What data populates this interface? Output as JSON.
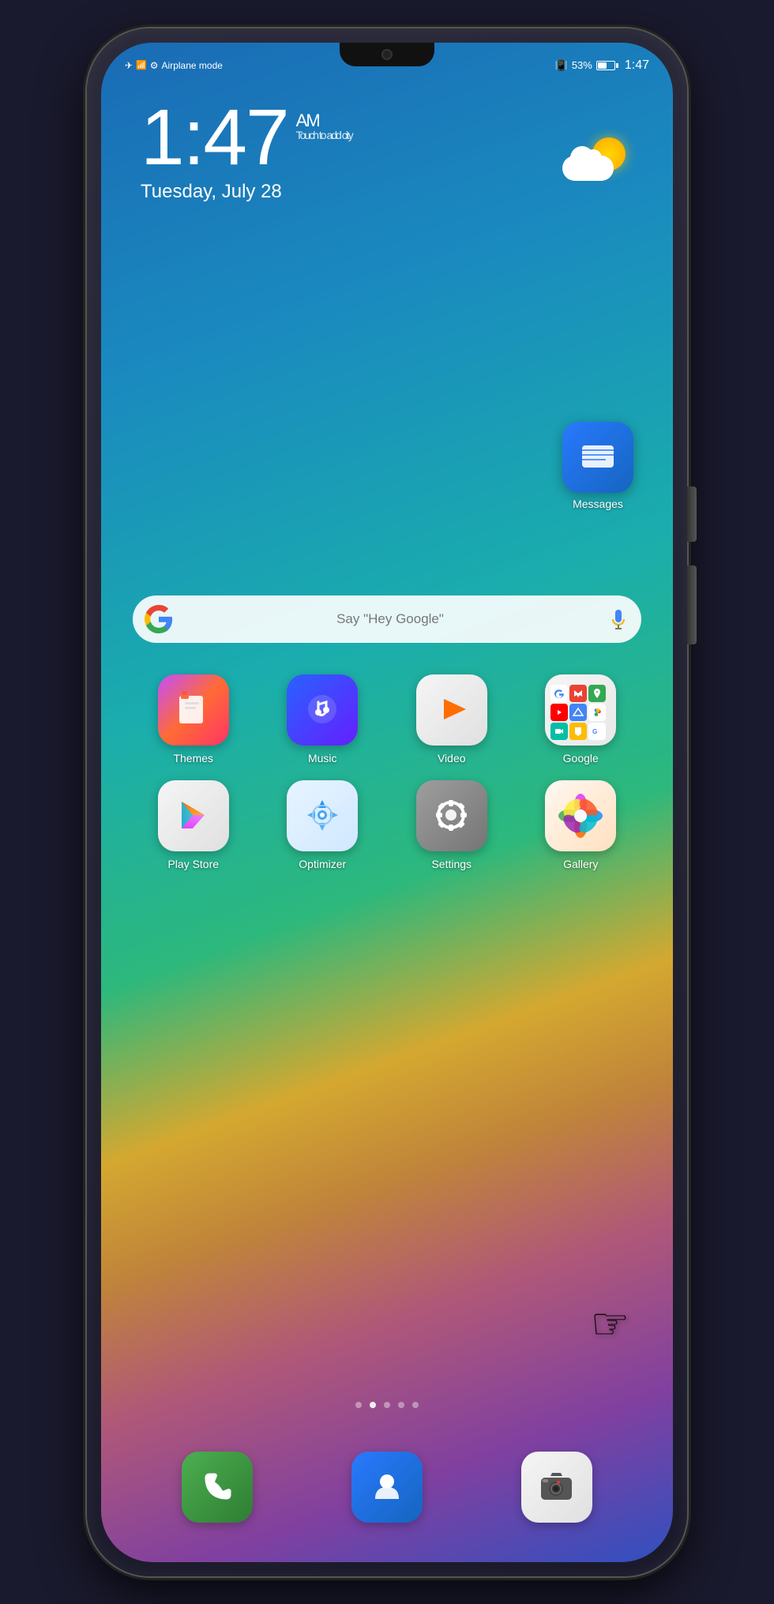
{
  "phone": {
    "status_bar": {
      "left_text": "Airplane mode",
      "battery_percent": "53%",
      "time": "1:47"
    },
    "clock": {
      "time": "1:47",
      "am_pm": "AM",
      "touch_text": "Touch to add city",
      "date": "Tuesday, July 28"
    },
    "search_bar": {
      "placeholder": "Say \"Hey Google\""
    },
    "apps": [
      {
        "id": "themes",
        "label": "Themes"
      },
      {
        "id": "music",
        "label": "Music"
      },
      {
        "id": "video",
        "label": "Video"
      },
      {
        "id": "google",
        "label": "Google"
      },
      {
        "id": "play-store",
        "label": "Play Store"
      },
      {
        "id": "optimizer",
        "label": "Optimizer"
      },
      {
        "id": "settings",
        "label": "Settings"
      },
      {
        "id": "gallery",
        "label": "Gallery"
      }
    ],
    "messages_label": "Messages",
    "dock": [
      {
        "id": "phone",
        "label": ""
      },
      {
        "id": "contacts",
        "label": ""
      },
      {
        "id": "camera",
        "label": ""
      }
    ],
    "page_dots": [
      0,
      1,
      2,
      3,
      4
    ],
    "active_dot": 1
  }
}
